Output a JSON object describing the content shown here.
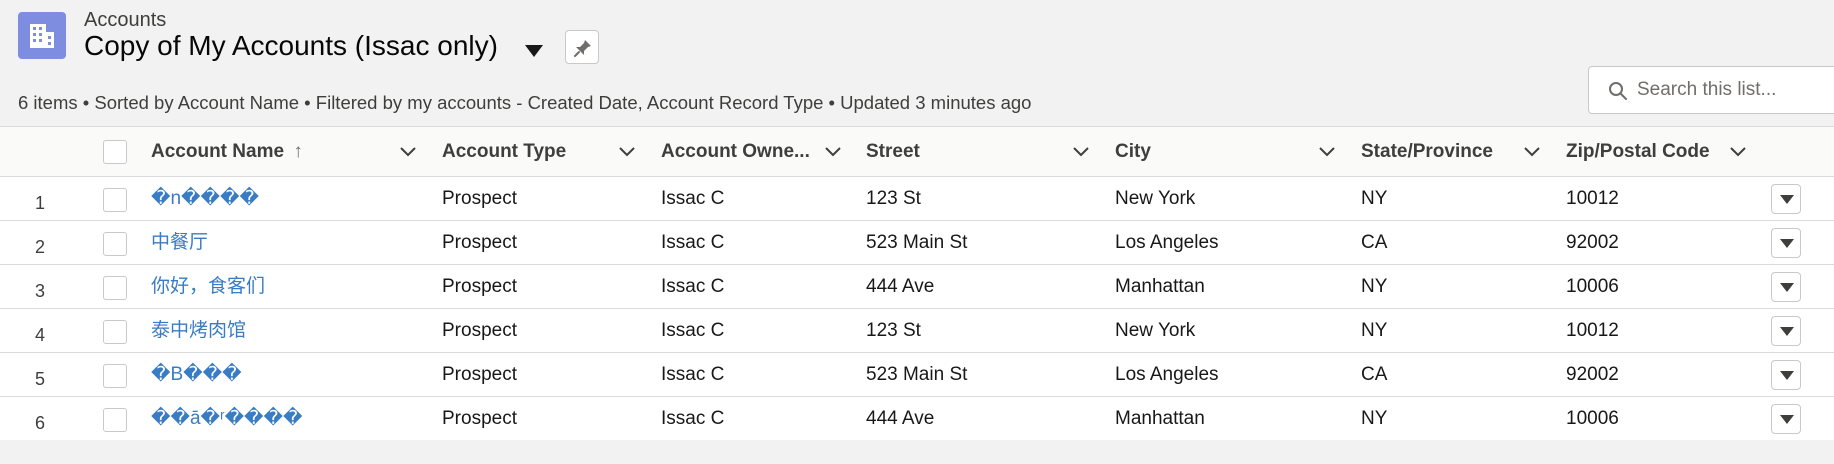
{
  "header": {
    "object_label": "Accounts",
    "list_title": "Copy of My Accounts (Issac only)",
    "meta": "6 items • Sorted by Account Name • Filtered by my accounts - Created Date, Account Record Type • Updated 3 minutes ago",
    "app_icon": "building-grid-icon",
    "pin_icon": "pin-icon"
  },
  "search": {
    "placeholder": "Search this list...",
    "value": "",
    "icon": "search-icon"
  },
  "table": {
    "columns": {
      "account_name": "Account Name",
      "sort_indicator": "↑",
      "account_type": "Account Type",
      "account_owner": "Account Owne...",
      "street": "Street",
      "city": "City",
      "state": "State/Province",
      "zip": "Zip/Postal Code"
    },
    "rows": [
      {
        "num": "1",
        "name": "�n����",
        "type": "Prospect",
        "owner": "Issac C",
        "street": "123 St",
        "city": "New York",
        "state": "NY",
        "zip": "10012"
      },
      {
        "num": "2",
        "name": "中餐厅",
        "type": "Prospect",
        "owner": "Issac C",
        "street": "523 Main St",
        "city": "Los Angeles",
        "state": "CA",
        "zip": "92002"
      },
      {
        "num": "3",
        "name": "你好，食客们",
        "type": "Prospect",
        "owner": "Issac C",
        "street": "444 Ave",
        "city": "Manhattan",
        "state": "NY",
        "zip": "10006"
      },
      {
        "num": "4",
        "name": "泰中烤肉馆",
        "type": "Prospect",
        "owner": "Issac C",
        "street": "123 St",
        "city": "New York",
        "state": "NY",
        "zip": "10012"
      },
      {
        "num": "5",
        "name": "�B���",
        "type": "Prospect",
        "owner": "Issac C",
        "street": "523 Main St",
        "city": "Los Angeles",
        "state": "CA",
        "zip": "92002"
      },
      {
        "num": "6",
        "name": "��ā�ʳ����",
        "type": "Prospect",
        "owner": "Issac C",
        "street": "444 Ave",
        "city": "Manhattan",
        "state": "NY",
        "zip": "10006"
      }
    ]
  },
  "colors": {
    "link": "#3a7cc4",
    "app_icon_bg": "#7f8de1",
    "page_bg": "#f3f2f2"
  }
}
